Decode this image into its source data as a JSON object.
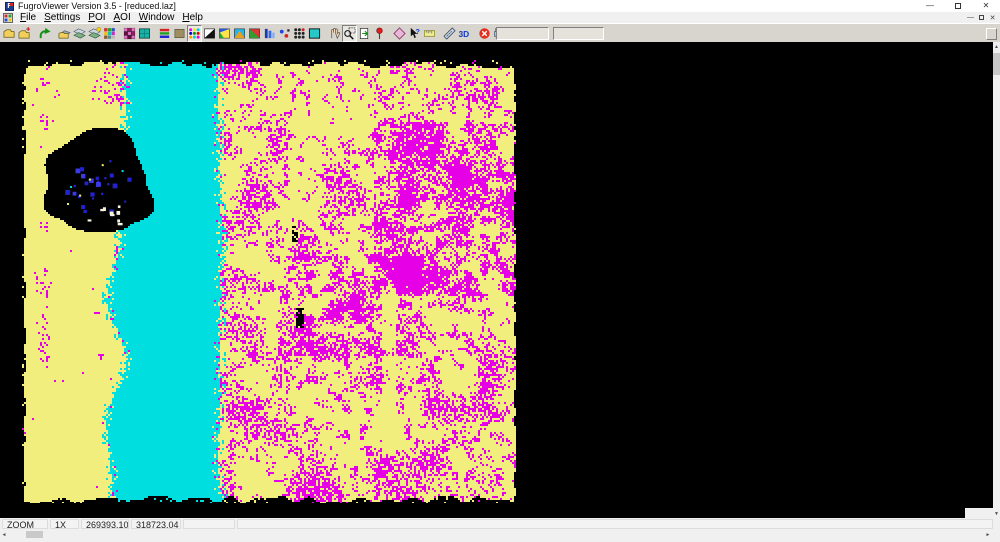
{
  "window": {
    "title": "FugroViewer Version 3.5 - [reduced.laz]",
    "app_icon_letter": "F",
    "controls": {
      "minimize": "—",
      "close": "✕"
    },
    "mdi_controls": {
      "minimize": "—",
      "close": "✕"
    }
  },
  "menu": {
    "items": [
      {
        "label": "File",
        "underline": 0
      },
      {
        "label": "Settings",
        "underline": 0
      },
      {
        "label": "POI",
        "underline": 0
      },
      {
        "label": "AOI",
        "underline": 0
      },
      {
        "label": "Window",
        "underline": 0
      },
      {
        "label": "Help",
        "underline": 0
      }
    ]
  },
  "toolbar": {
    "items": [
      {
        "icon": "open-folder",
        "name": "open-file"
      },
      {
        "icon": "open-folder-add",
        "name": "add-file"
      },
      {
        "sep": true
      },
      {
        "icon": "redo-arrow",
        "name": "reload"
      },
      {
        "sep": true
      },
      {
        "icon": "open-layers",
        "name": "open-project"
      },
      {
        "icon": "layers",
        "name": "layers"
      },
      {
        "icon": "layers-star",
        "name": "layers-highlight"
      },
      {
        "icon": "grid-colored",
        "name": "grid-view"
      },
      {
        "sep": true
      },
      {
        "icon": "intensity-image",
        "name": "intensity-image"
      },
      {
        "icon": "tin-surface",
        "name": "tin-surface"
      },
      {
        "sep": true
      },
      {
        "icon": "elevation-colors",
        "name": "color-by-elevation"
      },
      {
        "icon": "single-color",
        "name": "single-color"
      },
      {
        "icon": "classification-colors",
        "name": "color-by-classification",
        "pressed": true
      },
      {
        "icon": "intensity-bw",
        "name": "color-by-intensity"
      },
      {
        "icon": "rgb-split",
        "name": "color-by-rgb"
      },
      {
        "icon": "color-split-2",
        "name": "color-by-return"
      },
      {
        "icon": "color-split-3",
        "name": "color-by-source"
      },
      {
        "icon": "blue-bars",
        "name": "histogram"
      },
      {
        "icon": "profile-points",
        "name": "profile-points"
      },
      {
        "icon": "grid-points",
        "name": "point-grid"
      },
      {
        "icon": "select-area",
        "name": "select-area"
      },
      {
        "sep": true
      },
      {
        "icon": "pan-hand",
        "name": "pan"
      },
      {
        "icon": "zoom-window",
        "name": "zoom-window",
        "pressed": true
      },
      {
        "icon": "fit-page",
        "name": "fit-view"
      },
      {
        "icon": "poi-pin",
        "name": "poi"
      },
      {
        "sep": true
      },
      {
        "icon": "aoi-diamond",
        "name": "aoi"
      },
      {
        "icon": "help-cursor",
        "name": "identify"
      },
      {
        "icon": "measure-note",
        "name": "measure-info"
      },
      {
        "sep": true
      },
      {
        "icon": "measure-ruler",
        "name": "measure-distance"
      },
      {
        "icon": "view-3d",
        "name": "view-3d"
      },
      {
        "sep": true
      },
      {
        "icon": "close-red",
        "name": "close-view"
      },
      {
        "icon": "print",
        "name": "print"
      },
      {
        "icon": "export-image",
        "name": "export-image"
      }
    ],
    "fields": [
      {
        "value": ""
      },
      {
        "value": ""
      }
    ]
  },
  "statusbar": {
    "cells": [
      {
        "label": "ZOOM"
      },
      {
        "label": "1X"
      },
      {
        "label": "269393.10"
      },
      {
        "label": "318723.04"
      },
      {
        "label": ""
      },
      {
        "label": ""
      }
    ]
  },
  "viewer": {
    "file": "reduced.laz",
    "colors": {
      "background": "#000000",
      "ground": "#f1ee7d",
      "vegetation": "#e600e6",
      "water": "#00dedf",
      "water_points": "#2323cd",
      "bright_points": "#f4f4e0"
    }
  }
}
